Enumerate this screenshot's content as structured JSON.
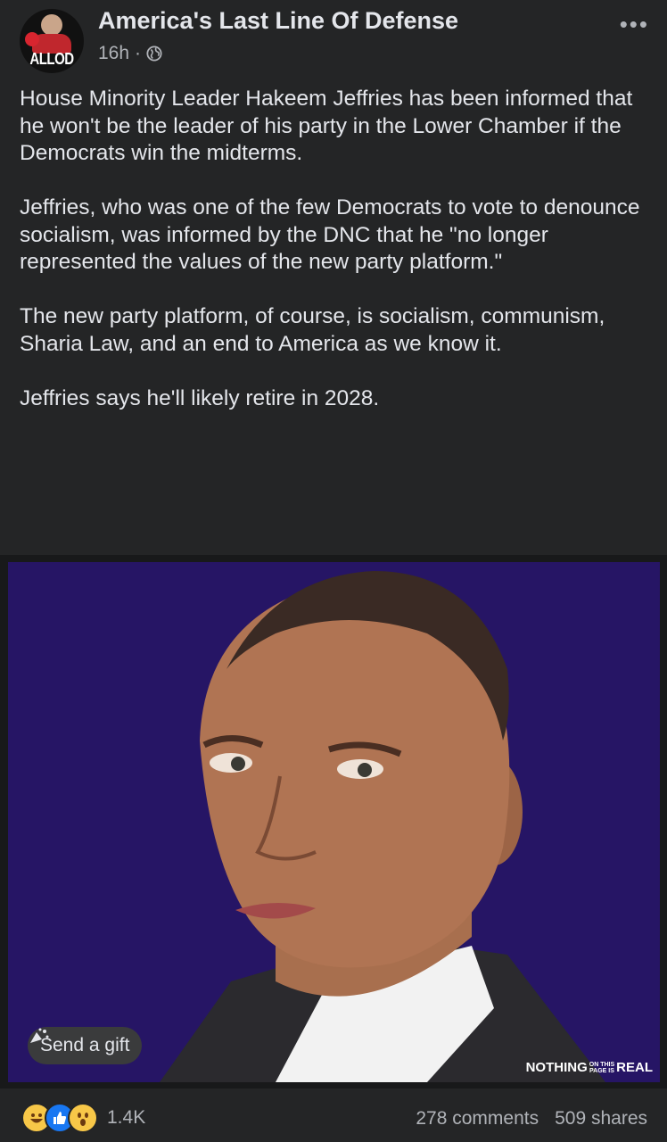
{
  "post": {
    "page_name": "America's Last Line Of Defense",
    "avatar_logo_text": "ALLOD",
    "time": "16h",
    "separator": "·",
    "more_label": "•••",
    "paragraphs": [
      "House Minority Leader Hakeem Jeffries has been informed that he won't be the leader of his party in the Lower Chamber if the Democrats win the midterms.",
      "Jeffries, who was one of the few Democrats to vote to denounce socialism, was informed by the DNC that he \"no longer represented the values of the new party platform.\"",
      "The new party platform, of course, is socialism, communism, Sharia Law, and an end to America as we know it.",
      "Jeffries says he'll likely retire in 2028."
    ]
  },
  "image": {
    "watermark_left": "NOTHING",
    "watermark_small_1": "ON THIS",
    "watermark_small_2": "PAGE IS",
    "watermark_right": "REAL",
    "background_color": "#261565"
  },
  "gift_button": {
    "label": "Send a gift",
    "icon": "gift-icon"
  },
  "footer": {
    "reaction_icons": [
      "laugh-emoji-icon",
      "like-icon",
      "wow-emoji-icon"
    ],
    "reaction_count": "1.4K",
    "comments": "278 comments",
    "shares": "509 shares"
  }
}
